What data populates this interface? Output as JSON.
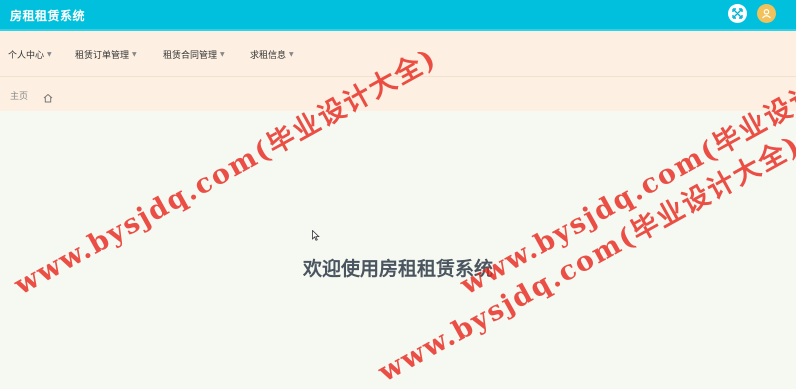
{
  "header": {
    "title": "房租租赁系统",
    "fullscreen_icon": "fullscreen-icon",
    "avatar_icon": "user-icon",
    "brand_color": "#00c0dd"
  },
  "nav": {
    "items": [
      {
        "label": "个人中心"
      },
      {
        "label": "租赁订单管理"
      },
      {
        "label": "租赁合同管理"
      },
      {
        "label": "求租信息"
      }
    ]
  },
  "breadcrumb": {
    "home": "主页",
    "icon": "home-icon"
  },
  "main": {
    "welcome": "欢迎使用房租租赁系统"
  },
  "watermark": {
    "text": "www.bysjdq.com(毕业设计大全)"
  }
}
